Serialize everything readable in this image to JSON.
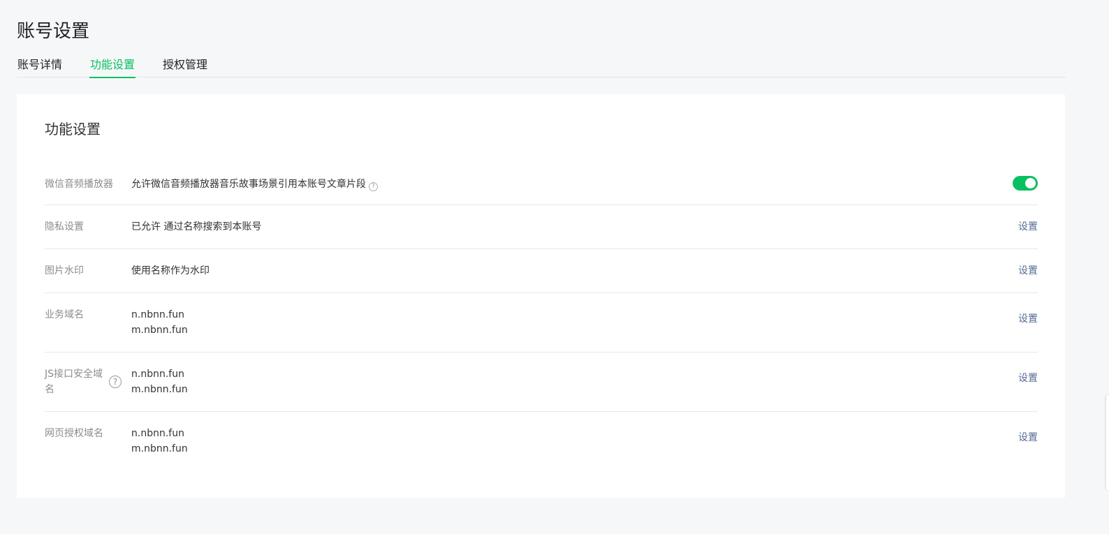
{
  "page_title": "账号设置",
  "tabs": [
    {
      "label": "账号详情",
      "active": false
    },
    {
      "label": "功能设置",
      "active": true
    },
    {
      "label": "授权管理",
      "active": false
    }
  ],
  "card": {
    "title": "功能设置",
    "rows": [
      {
        "label": "微信音频播放器",
        "value": "允许微信音频播放器音乐故事场景引用本账号文章片段",
        "value_help_icon": "question-circle-icon",
        "control": "toggle",
        "toggle_on": true
      },
      {
        "label": "隐私设置",
        "value": "已允许 通过名称搜索到本账号",
        "action": "设置"
      },
      {
        "label": "图片水印",
        "value": "使用名称作为水印",
        "action": "设置"
      },
      {
        "label": "业务域名",
        "values": [
          "n.nbnn.fun",
          "m.nbnn.fun"
        ],
        "action": "设置"
      },
      {
        "label": "JS接口安全域名",
        "label_help_icon": "question-circle-icon",
        "values": [
          "n.nbnn.fun",
          "m.nbnn.fun"
        ],
        "action": "设置"
      },
      {
        "label": "网页授权域名",
        "values": [
          "n.nbnn.fun",
          "m.nbnn.fun"
        ],
        "action": "设置"
      }
    ]
  },
  "colors": {
    "accent": "#07c160",
    "link": "#576b95",
    "background": "#f6f7f9"
  }
}
